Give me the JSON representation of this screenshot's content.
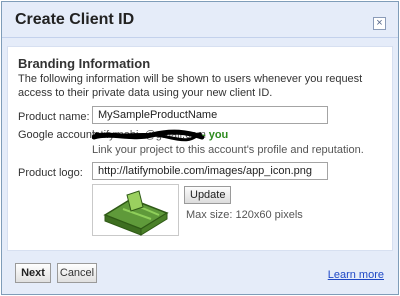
{
  "dialog": {
    "title": "Create Client ID",
    "close_icon": "close-icon",
    "close_glyph": "×"
  },
  "branding": {
    "heading": "Branding Information",
    "intro": "The following information will be shown to users whenever you request access to their private data using your new client ID."
  },
  "form": {
    "product_name_label": "Product name:",
    "product_name_value": "MySampleProductName",
    "google_account_label": "Google account:",
    "google_account_value": "latifymobi..@gmail.com",
    "google_account_suffix": "- you",
    "link_note": "Link your project to this account's profile and reputation.",
    "product_logo_label": "Product logo:",
    "product_logo_value": "http://latifymobile.com/images/app_icon.png",
    "update_label": "Update",
    "max_size": "Max size: 120x60 pixels"
  },
  "footer": {
    "next_label": "Next",
    "cancel_label": "Cancel",
    "learn_more_label": "Learn more"
  },
  "colors": {
    "dialog_bg": "#e5ecf9",
    "you_green": "#2e8b1f",
    "link_blue": "#1f48c6",
    "logo_green": "#6aa84f"
  }
}
